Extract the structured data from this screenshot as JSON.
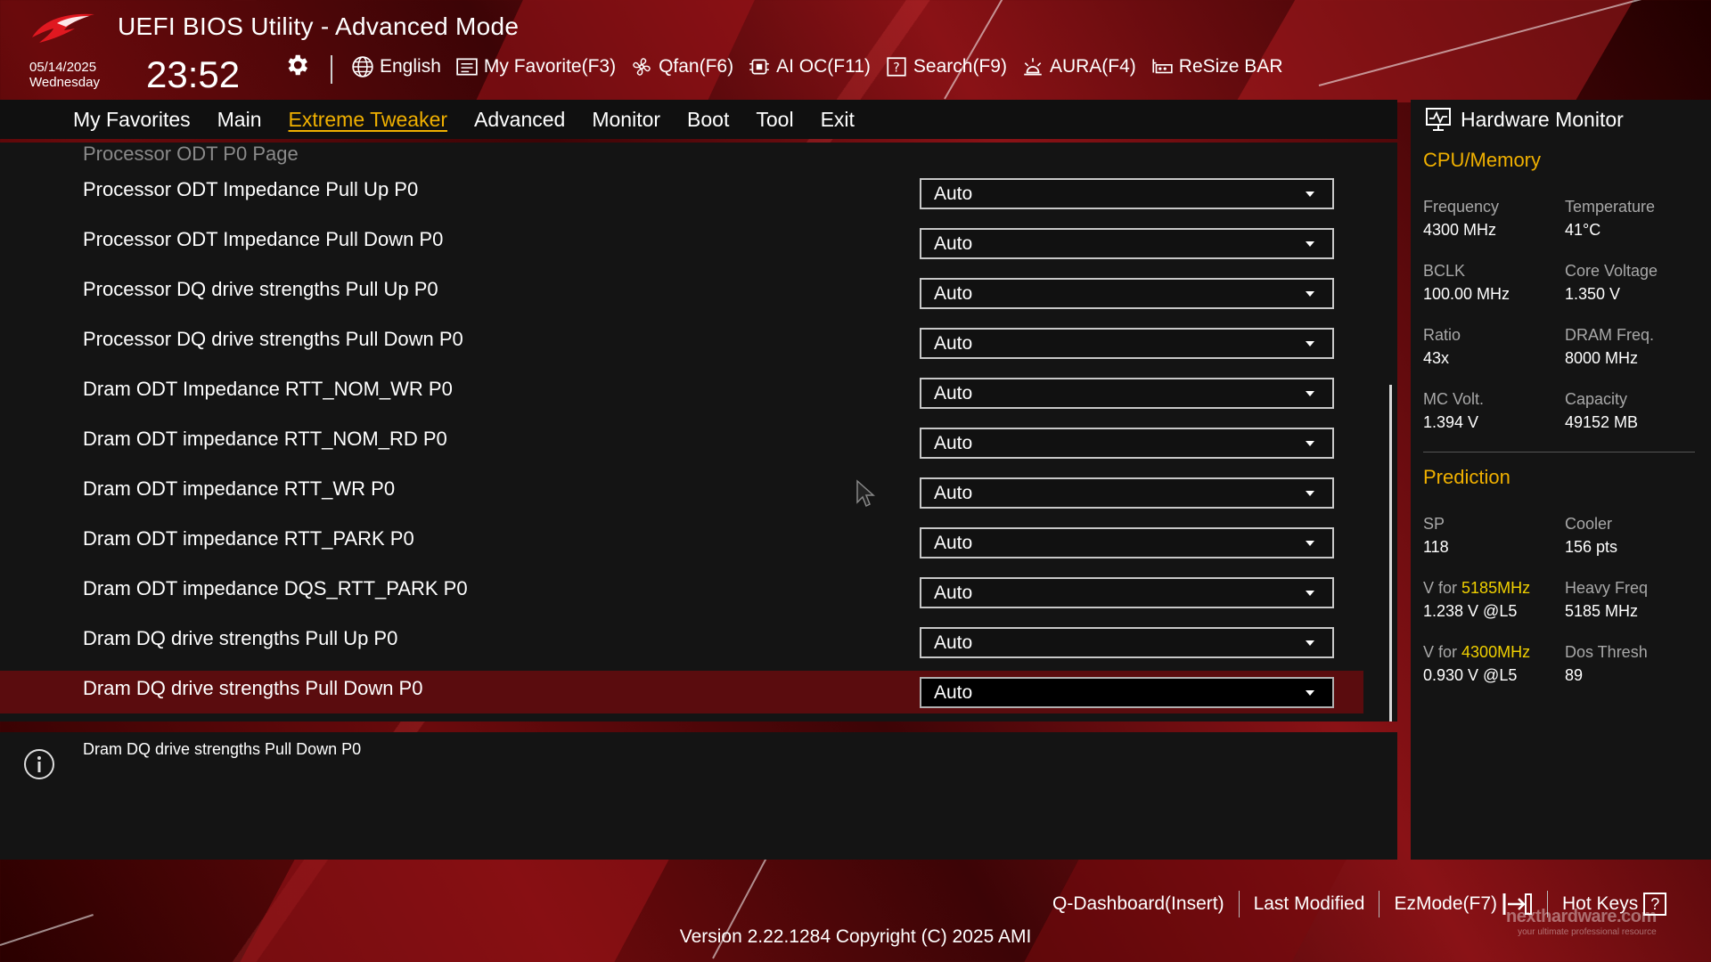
{
  "header": {
    "title": "UEFI BIOS Utility - Advanced Mode",
    "date": "05/14/2025",
    "weekday": "Wednesday",
    "time": "23:52"
  },
  "toolbar": {
    "language": "English",
    "my_favorite": "My Favorite(F3)",
    "qfan": "Qfan(F6)",
    "ai_oc": "AI OC(F11)",
    "search": "Search(F9)",
    "aura": "AURA(F4)",
    "resize_bar": "ReSize BAR"
  },
  "tabs": [
    "My Favorites",
    "Main",
    "Extreme Tweaker",
    "Advanced",
    "Monitor",
    "Boot",
    "Tool",
    "Exit"
  ],
  "active_tab": "Extreme Tweaker",
  "main": {
    "page_header": "Processor ODT P0 Page",
    "settings": [
      {
        "label": "Processor ODT Impedance Pull Up P0",
        "value": "Auto"
      },
      {
        "label": "Processor ODT Impedance Pull Down P0",
        "value": "Auto"
      },
      {
        "label": "Processor DQ drive strengths Pull Up P0",
        "value": "Auto"
      },
      {
        "label": "Processor DQ drive strengths Pull Down P0",
        "value": "Auto"
      },
      {
        "label": "Dram ODT Impedance RTT_NOM_WR P0",
        "value": "Auto"
      },
      {
        "label": "Dram ODT impedance RTT_NOM_RD P0",
        "value": "Auto"
      },
      {
        "label": "Dram ODT impedance RTT_WR P0",
        "value": "Auto"
      },
      {
        "label": "Dram ODT impedance RTT_PARK P0",
        "value": "Auto"
      },
      {
        "label": "Dram ODT impedance DQS_RTT_PARK P0",
        "value": "Auto"
      },
      {
        "label": "Dram DQ drive strengths Pull Up P0",
        "value": "Auto"
      },
      {
        "label": "Dram DQ drive strengths Pull Down P0",
        "value": "Auto"
      }
    ],
    "selected_index": 10
  },
  "help": {
    "text": "Dram DQ drive strengths Pull Down P0"
  },
  "hardware_monitor": {
    "title": "Hardware Monitor",
    "cpu_memory": {
      "heading": "CPU/Memory",
      "frequency_label": "Frequency",
      "frequency": "4300 MHz",
      "temperature_label": "Temperature",
      "temperature": "41°C",
      "bclk_label": "BCLK",
      "bclk": "100.00 MHz",
      "core_voltage_label": "Core Voltage",
      "core_voltage": "1.350 V",
      "ratio_label": "Ratio",
      "ratio": "43x",
      "dram_freq_label": "DRAM Freq.",
      "dram_freq": "8000 MHz",
      "mc_volt_label": "MC Volt.",
      "mc_volt": "1.394 V",
      "capacity_label": "Capacity",
      "capacity": "49152 MB"
    },
    "prediction": {
      "heading": "Prediction",
      "sp_label": "SP",
      "sp": "118",
      "cooler_label": "Cooler",
      "cooler": "156 pts",
      "v_for_label": "V for",
      "v_for_1_freq": "5185MHz",
      "v_for_1": "1.238 V @L5",
      "heavy_freq_label": "Heavy Freq",
      "heavy_freq": "5185 MHz",
      "v_for_2_freq": "4300MHz",
      "v_for_2": "0.930 V @L5",
      "dos_thresh_label": "Dos Thresh",
      "dos_thresh": "89"
    }
  },
  "footer": {
    "q_dashboard": "Q-Dashboard(Insert)",
    "last_modified": "Last Modified",
    "ezmode": "EzMode(F7)",
    "hot_keys": "Hot Keys",
    "hot_keys_icon": "?",
    "version": "Version 2.22.1284 Copyright (C) 2025 AMI"
  },
  "watermark": {
    "brand": "nexthardware.com",
    "tagline": "your ultimate professional resource"
  },
  "colors": {
    "accent": "#f0b000",
    "highlight": "#f0d000",
    "selected_row": "#5a0c0e",
    "panel": "#141414"
  }
}
